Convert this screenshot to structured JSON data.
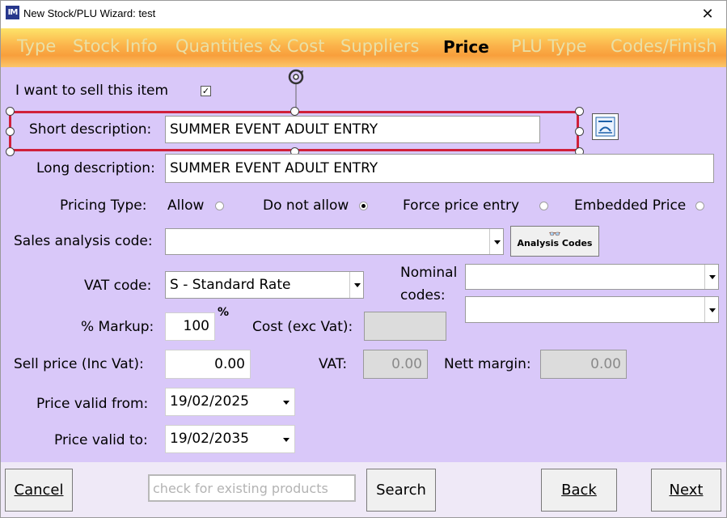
{
  "window": {
    "title": "New Stock/PLU Wizard: test",
    "icon_text": "IM",
    "close_glyph": "✕"
  },
  "tabs": [
    {
      "label": "Type"
    },
    {
      "label": "Stock Info"
    },
    {
      "label": "Quantities & Cost"
    },
    {
      "label": "Suppliers"
    },
    {
      "label": "Price",
      "active": true
    },
    {
      "label": "PLU Type"
    },
    {
      "label": "Codes/Finish"
    }
  ],
  "form": {
    "sell_item_label": "I want to sell this item",
    "sell_item_checked": true,
    "short_desc_label": "Short description:",
    "short_desc_value": "SUMMER EVENT ADULT ENTRY",
    "long_desc_label": "Long description:",
    "long_desc_value": "SUMMER EVENT ADULT ENTRY",
    "pricing_type_label": "Pricing Type:",
    "pricing_options": [
      {
        "label": "Allow",
        "selected": false
      },
      {
        "label": "Do not allow",
        "selected": true
      },
      {
        "label": "Force price entry",
        "selected": false
      },
      {
        "label": "Embedded Price",
        "selected": false
      }
    ],
    "sales_analysis_label": "Sales analysis code:",
    "sales_analysis_value": "",
    "analysis_codes_button": "Analysis Codes",
    "vat_code_label": "VAT code:",
    "vat_code_value": "S - Standard Rate",
    "nominal_codes_label_1": "Nominal",
    "nominal_codes_label_2": "codes:",
    "nominal_code_1": "",
    "nominal_code_2": "",
    "markup_label": "% Markup:",
    "markup_value": "100",
    "markup_unit": "%",
    "cost_label": "Cost (exc Vat):",
    "cost_value": "",
    "sell_price_label": "Sell price (Inc Vat):",
    "sell_price_value": "0.00",
    "vat_label": "VAT:",
    "vat_value": "0.00",
    "nett_margin_label": "Nett margin:",
    "nett_margin_value": "0.00",
    "valid_from_label": "Price valid from:",
    "valid_from_value": "19/02/2025",
    "valid_to_label": "Price valid to:",
    "valid_to_value": "19/02/2035"
  },
  "footer": {
    "cancel": "Cancel",
    "search_placeholder": "check for existing products",
    "search": "Search",
    "back": "Back",
    "next": "Next"
  },
  "colors": {
    "background": "#d9c8f9",
    "tab_active": "#000000",
    "tab_inactive": "#e9e0a6",
    "selection": "#d0203a"
  }
}
